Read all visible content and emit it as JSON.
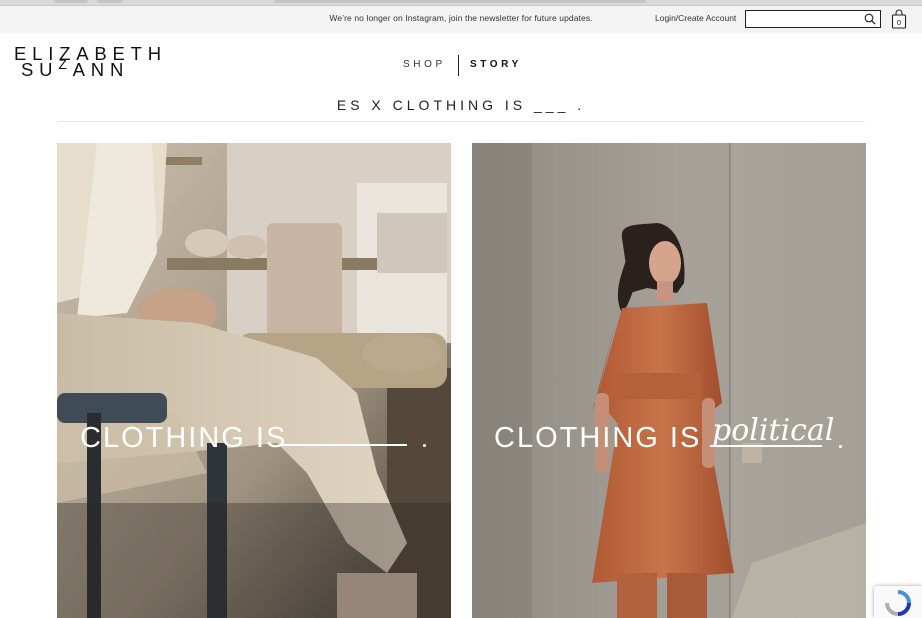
{
  "announcement": "We’re no longer on Instagram, join the newsletter for future updates.",
  "account": {
    "login_label": "Login/Create Account"
  },
  "search": {
    "placeholder": ""
  },
  "cart": {
    "count": "0"
  },
  "brand": {
    "line1": "ELIZABETH",
    "line2_a": "SU",
    "line2_z": "Z",
    "line2_b": "ANN"
  },
  "nav": {
    "shop": "SHOP",
    "story": "STORY"
  },
  "tagline": "ES X CLOTHING IS ___ .",
  "panels": [
    {
      "caption": "CLOTHING IS",
      "fill_word": ""
    },
    {
      "caption": "CLOTHING IS",
      "fill_word": "political"
    }
  ],
  "icons": {
    "search": "search-icon",
    "cart": "shopping-bag-icon",
    "recaptcha": "recaptcha-icon"
  }
}
